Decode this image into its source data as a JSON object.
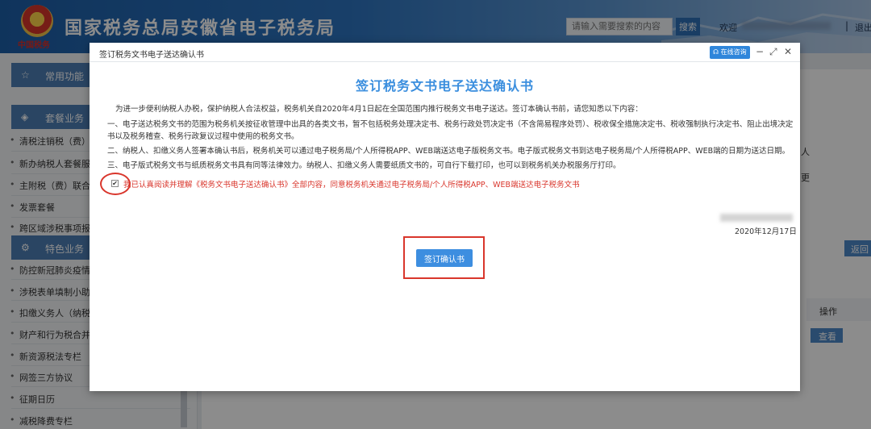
{
  "header": {
    "site_title": "国家税务总局安徽省电子税务局",
    "emblem_text": "中国税务",
    "search_placeholder": "请输入需要搜索的内容",
    "search_button": "搜索",
    "welcome": "欢迎",
    "separator": "|",
    "logout": "退出"
  },
  "sidebar": {
    "groups": [
      {
        "label": "常用功能",
        "icon": "star-icon"
      },
      {
        "label": "套餐业务",
        "icon": "cube-icon"
      },
      {
        "label": "特色业务",
        "icon": "gears-icon"
      }
    ],
    "package_items": [
      "清税注销税（费）",
      "新办纳税人套餐服",
      "主附税（费）联合",
      "发票套餐",
      "跨区域涉税事项报"
    ],
    "feature_items": [
      "防控新冠肺炎疫情",
      "涉税表单填制小助",
      "扣缴义务人（纳税",
      "财产和行为税合并",
      "新资源税法专栏",
      "网签三方协议",
      "征期日历",
      "减税降费专栏"
    ]
  },
  "background": {
    "snippet_1": "人",
    "snippet_2": "更",
    "return_button": "返回",
    "operation_header": "操作",
    "view_button": "查看"
  },
  "modal": {
    "title": "签订税务文书电子送达确认书",
    "consult_button": "在线咨询",
    "controls": [
      "minimize-icon",
      "maximize-icon",
      "close-icon"
    ],
    "doc_title": "签订税务文书电子送达确认书",
    "intro": "为进一步便利纳税人办税，保护纳税人合法权益，税务机关自2020年4月1日起在全国范围内推行税务文书电子送达。签订本确认书前，请您知悉以下内容：",
    "item_1": "一、电子送达税务文书的范围为税务机关按征收管理中出具的各类文书，暂不包括税务处理决定书、税务行政处罚决定书（不含简易程序处罚）、税收保全措施决定书、税收强制执行决定书、阻止出境决定书以及税务稽查、税务行政复议过程中使用的税务文书。",
    "item_2": "二、纳税人、扣缴义务人签署本确认书后，税务机关可以通过电子税务局/个人所得税APP、WEB端送达电子版税务文书。电子版式税务文书到达电子税务局/个人所得税APP、WEB端的日期为送达日期。",
    "item_3": "三、电子版式税务文书与纸质税务文书具有同等法律效力。纳税人、扣缴义务人需要纸质文书的，可自行下载打印，也可以到税务机关办税服务厅打印。",
    "confirm_checked": true,
    "confirm_text": "我已认真阅读并理解《税务文书电子送达确认书》全部内容，同意税务机关通过电子税务局/个人所得税APP、WEB端送达电子税务文书",
    "date": "2020年12月17日",
    "sign_button": "签订确认书"
  },
  "colors": {
    "accent": "#3a8ede",
    "highlight": "#d9362c",
    "header_blue": "#1d5fa8"
  }
}
